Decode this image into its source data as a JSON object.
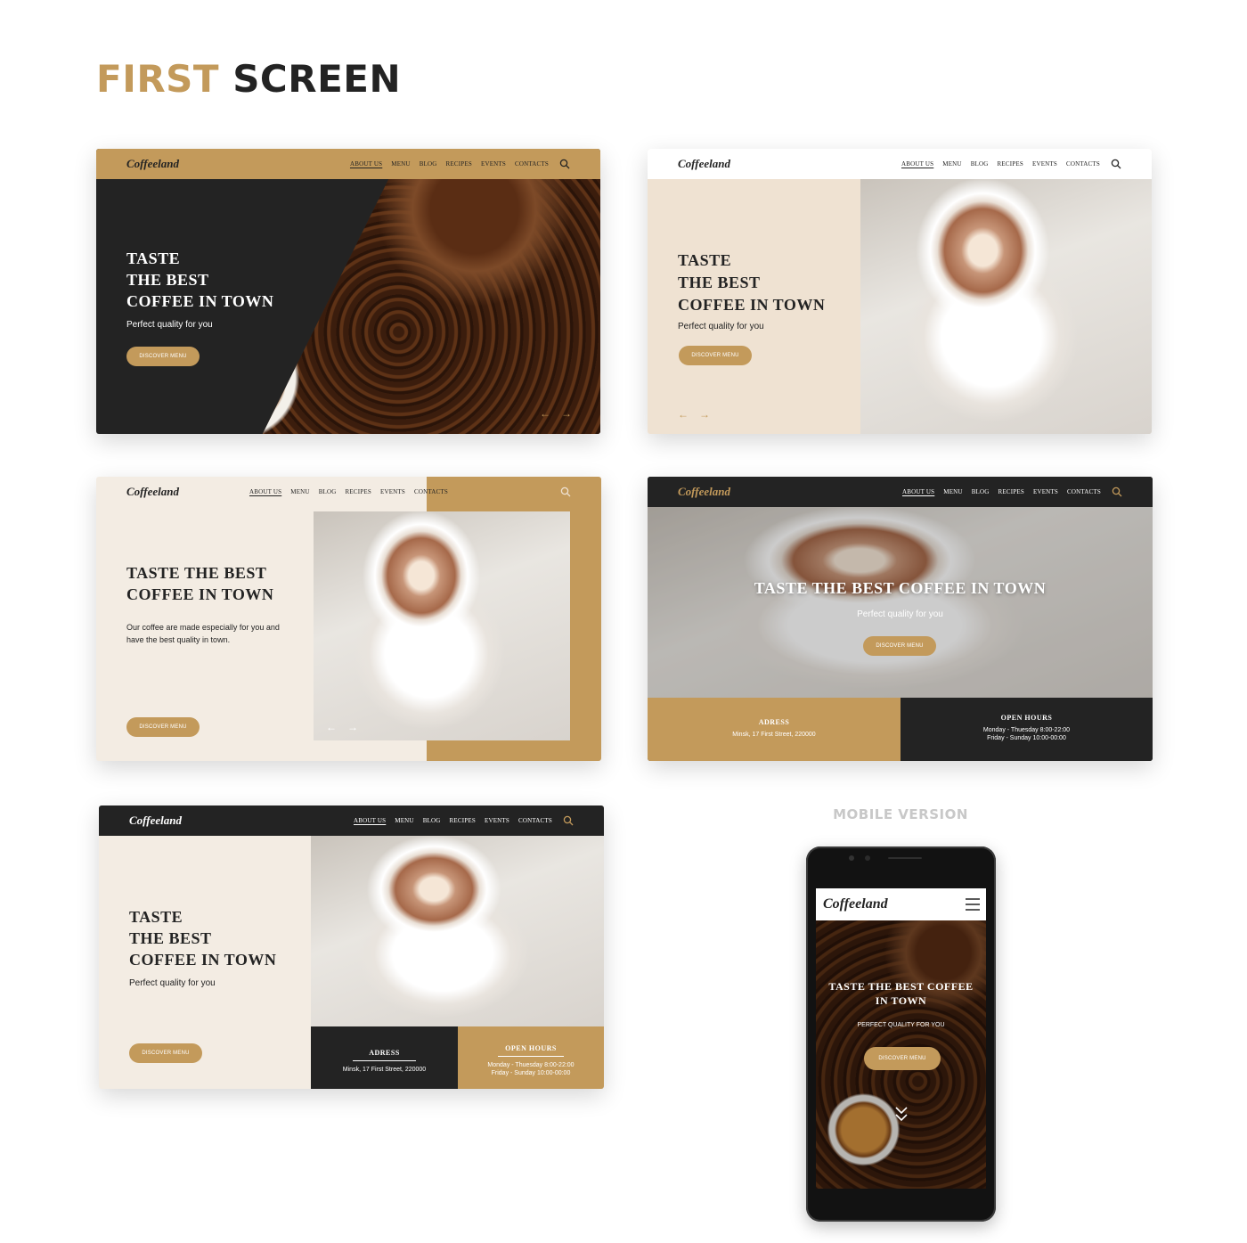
{
  "page": {
    "title_accent": "FIRST",
    "title_rest": "SCREEN",
    "mobile_label": "MOBILE VERSION"
  },
  "brand": "Coffeeland",
  "nav_items": [
    "ABOUT US",
    "MENU",
    "BLOG",
    "RECIPES",
    "EVENTS",
    "CONTACTS"
  ],
  "hero": {
    "headline_3line": "TASTE\nTHE BEST\nCOFFEE IN TOWN",
    "headline_2line": "TASTE THE BEST\nCOFFEE IN TOWN",
    "headline_1line": "TASTE THE BEST COFFEE IN TOWN",
    "tagline": "Perfect quality for you",
    "tagline_long": "Our coffee are made especially for you and have the best quality in town.",
    "button": "DISCOVER MENU"
  },
  "info": {
    "address_title": "ADRESS",
    "address": "Minsk, 17 First Street, 220000",
    "hours_title": "OPEN HOURS",
    "hours_weekday": "Monday - Thuesday 8:00-22:00",
    "hours_weekend": "Friday - Sunday 10:00-00:00"
  },
  "mobile": {
    "headline": "TASTE THE BEST COFFEE IN TOWN",
    "tagline": "PERFECT QUALITY FOR YOU",
    "button": "DISCOVER MENU"
  },
  "colors": {
    "accent": "#c39a5b",
    "dark": "#232323",
    "cream": "#f3ece3",
    "beige": "#efe2d2"
  },
  "icons": [
    "search-icon",
    "arrow-left-icon",
    "arrow-right-icon",
    "hamburger-menu-icon",
    "chevron-down-icon"
  ]
}
